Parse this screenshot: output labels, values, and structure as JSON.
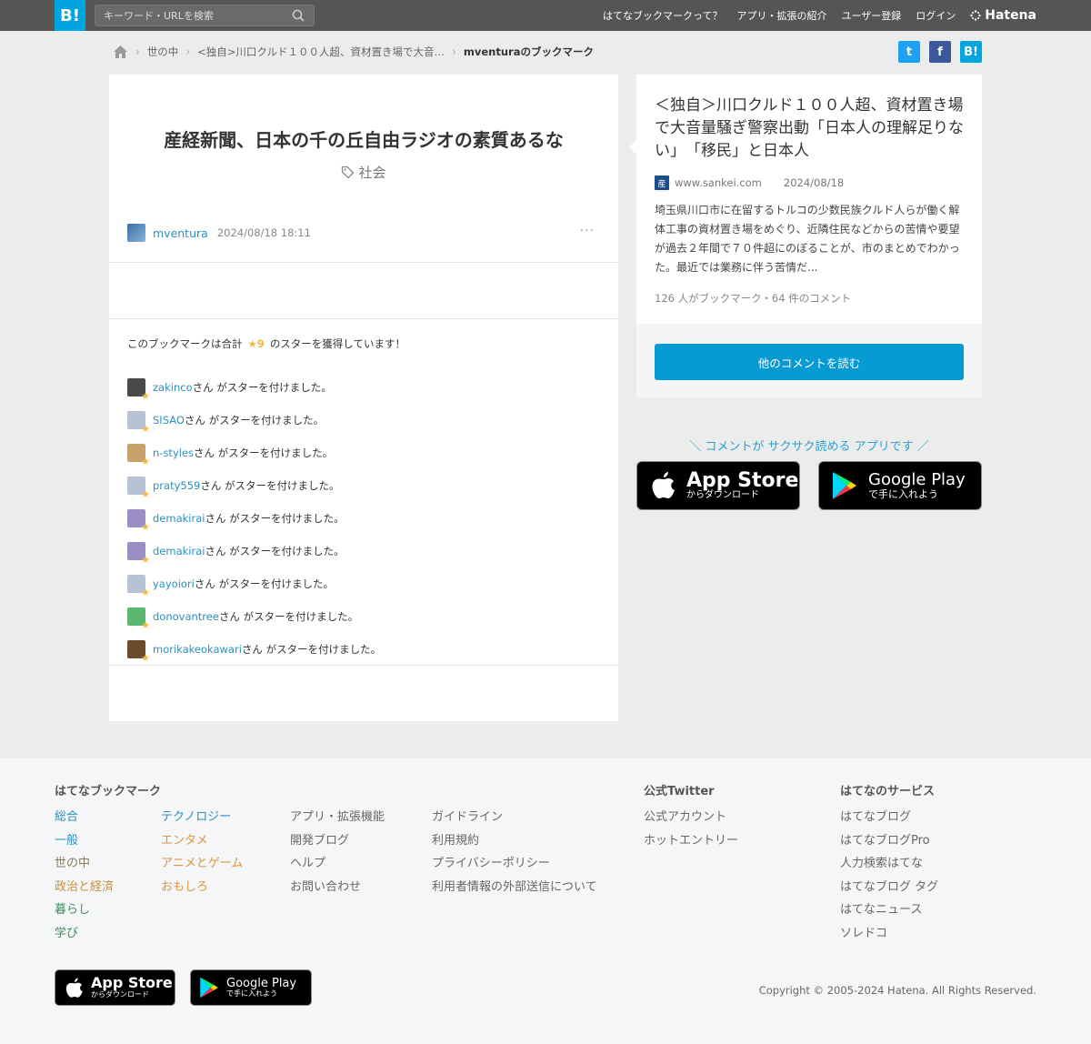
{
  "header": {
    "logo_label": "B!",
    "search_placeholder": "キーワード・URLを検索",
    "nav": [
      "はてなブックマークって？",
      "アプリ・拡張の紹介",
      "ユーザー登録",
      "ログイン"
    ],
    "brand": "Hatena"
  },
  "breadcrumb": {
    "items": [
      "世の中",
      "<独自>川口クルド１００人超、資材置き場で大音…"
    ],
    "current": "mventuraのブックマーク"
  },
  "share": {
    "twitter": "t",
    "facebook": "f",
    "hatena": "B!"
  },
  "bookmark": {
    "comment": "産経新聞、日本の千の丘自由ラジオの素質あるな",
    "tag": "社会",
    "user": "mventura",
    "date": "2024/08/18 18:11",
    "more": "···"
  },
  "stars": {
    "summary_prefix": "このブックマークは合計",
    "count": "★9",
    "summary_suffix": "のスターを獲得しています！",
    "suffix_text": "さん がスターを付けました。",
    "users": [
      {
        "name": "zakinco",
        "color": "#4a4a4a"
      },
      {
        "name": "SISAO",
        "color": "#b7c2d3"
      },
      {
        "name": "n-styles",
        "color": "#c8a26a"
      },
      {
        "name": "praty559",
        "color": "#b7c2d3"
      },
      {
        "name": "demakirai",
        "color": "#9b8ec4"
      },
      {
        "name": "demakirai",
        "color": "#9b8ec4"
      },
      {
        "name": "yayoiori",
        "color": "#b7c2d3"
      },
      {
        "name": "donovantree",
        "color": "#5cb870"
      },
      {
        "name": "morikakeokawari",
        "color": "#6b4a2e"
      }
    ]
  },
  "entry": {
    "title": "＜独自＞川口クルド１００人超、資材置き場で大音量騒ぎ警察出動「日本人の理解足りない」　「移民」と日本人",
    "site": "www.sankei.com",
    "favicon_label": "産",
    "date": "2024/08/18",
    "summary": "埼玉県川口市に在留するトルコの少数民族クルド人らが働く解体工事の資材置き場をめぐり、近隣住民などからの苦情や要望が過去２年間で７０件超にのぼることが、市のまとめでわかった。最近では業務に伴う苦情だ...",
    "counts": "126 人がブックマーク・64 件のコメント",
    "read_button": "他のコメントを読む"
  },
  "app_promo": {
    "text": "＼ コメントが サクサク読める アプリです ／",
    "app_store_main": "App Store",
    "app_store_sub": "からダウンロード",
    "google_play_main": "Google Play",
    "google_play_sub": "で手に入れよう"
  },
  "footer": {
    "title_hb": "はてなブックマーク",
    "col1": [
      "総合",
      "一般",
      "世の中",
      "政治と経済",
      "暮らし",
      "学び"
    ],
    "col1_colors": [
      "#2c8fbf",
      "#2c8fbf",
      "#8a7a5c",
      "#c68f3e",
      "#3e8f5f",
      "#3e8f5f"
    ],
    "col2": [
      "テクノロジー",
      "エンタメ",
      "アニメとゲーム",
      "おもしろ"
    ],
    "col2_colors": [
      "#2c8fbf",
      "#d9953f",
      "#d9953f",
      "#d9953f"
    ],
    "col3": [
      "アプリ・拡張機能",
      "開発ブログ",
      "ヘルプ",
      "お問い合わせ"
    ],
    "col4": [
      "ガイドライン",
      "利用規約",
      "プライバシーポリシー",
      "利用者情報の外部送信について"
    ],
    "title_twitter": "公式Twitter",
    "col5": [
      "公式アカウント",
      "ホットエントリー"
    ],
    "title_services": "はてなのサービス",
    "col6": [
      "はてなブログ",
      "はてなブログPro",
      "人力検索はてな",
      "はてなブログ タグ",
      "はてなニュース",
      "ソレドコ"
    ],
    "copyright": "Copyright © 2005-2024 Hatena. All Rights Reserved."
  }
}
